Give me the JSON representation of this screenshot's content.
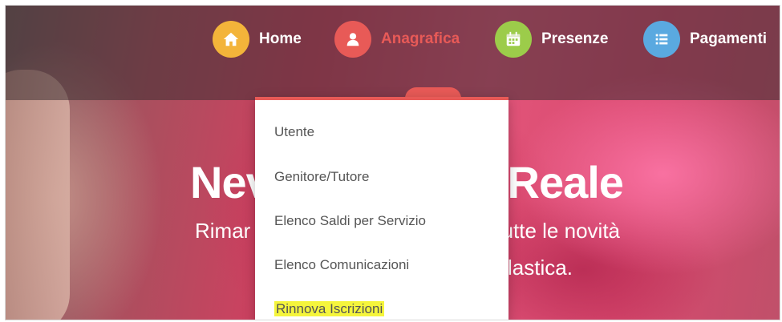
{
  "nav": {
    "items": [
      {
        "label": "Home",
        "icon": "home-icon",
        "color": "#f3b43a"
      },
      {
        "label": "Anagrafica",
        "icon": "user-icon",
        "color": "#e85a57",
        "active": true
      },
      {
        "label": "Presenze",
        "icon": "calendar-icon",
        "color": "#9ccc4a"
      },
      {
        "label": "Pagamenti",
        "icon": "list-icon",
        "color": "#5aa9e0"
      }
    ]
  },
  "hero": {
    "title_left": "Nev",
    "title_right": "o Reale",
    "subtitle_left": "Rimar",
    "subtitle_right": "tutte le novità",
    "subtitle2_right": "lastica."
  },
  "dropdown": {
    "items": [
      {
        "label": "Utente"
      },
      {
        "label": "Genitore/Tutore"
      },
      {
        "label": "Elenco Saldi per Servizio"
      },
      {
        "label": "Elenco Comunicazioni"
      },
      {
        "label": "Rinnova Iscrizioni",
        "highlight_color": "#f5f53c"
      }
    ]
  }
}
